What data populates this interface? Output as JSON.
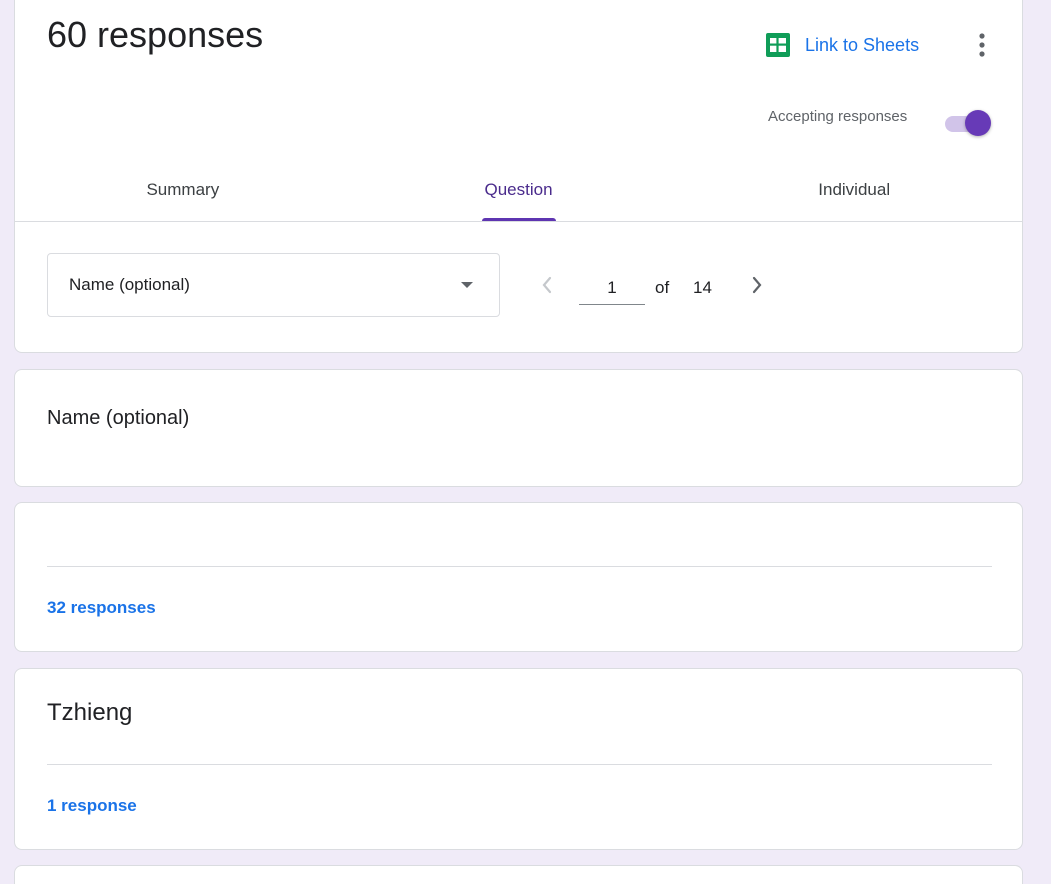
{
  "header": {
    "title": "60 responses",
    "sheets_link_label": "Link to Sheets",
    "accepting_label": "Accepting responses",
    "accepting_on": true,
    "colors": {
      "accent": "#673ab7",
      "link": "#1a73e8",
      "sheets_green": "#0f9d58"
    }
  },
  "tabs": [
    {
      "label": "Summary",
      "active": false
    },
    {
      "label": "Question",
      "active": true
    },
    {
      "label": "Individual",
      "active": false
    }
  ],
  "question_nav": {
    "selected_question": "Name (optional)",
    "current_index": "1",
    "of_label": "of",
    "total": "14"
  },
  "question_card": {
    "title": "Name (optional)"
  },
  "answer_groups": [
    {
      "answer": "",
      "count_label": "32 responses"
    },
    {
      "answer": "Tzhieng",
      "count_label": "1 response"
    }
  ],
  "icons": {
    "sheets": "sheets-icon",
    "more": "more-vert-icon",
    "dropdown": "dropdown-arrow-icon",
    "prev": "chevron-left-icon",
    "next": "chevron-right-icon"
  }
}
